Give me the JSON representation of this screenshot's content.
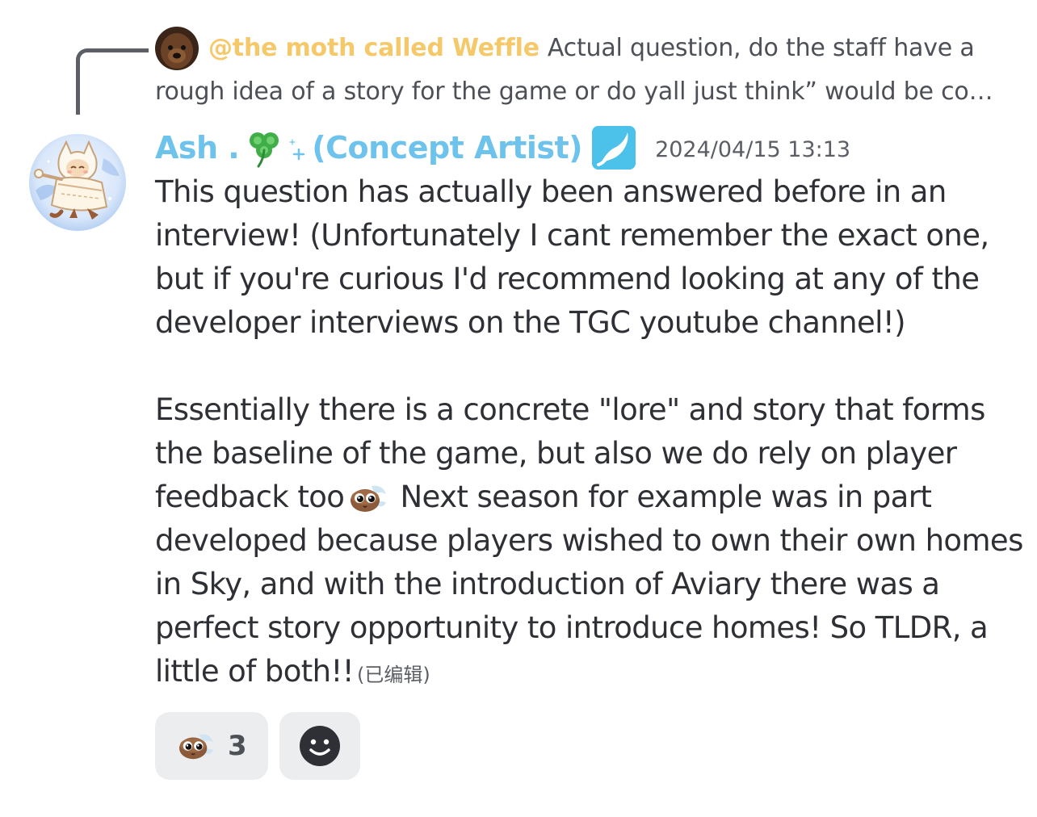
{
  "reply": {
    "author": "@the moth called Weffle",
    "preview_line1": "Actual question, do the staff have a",
    "preview_line2": "rough idea of a story for the game or do yall just think” would be co…"
  },
  "message": {
    "username_prefix": "Ash .",
    "username_suffix": "(Concept Artist)",
    "username_color": "#6ec3ec",
    "role_icon": "paint-stroke-icon",
    "timestamp": "2024/04/15 13:13",
    "lines": [
      "This question has actually been answered before in an",
      "interview! (Unfortunately I cant remember the exact one,",
      "but if you're curious I'd recommend looking at any of the",
      "developer interviews on the TGC youtube channel!)",
      "Essentially there is a concrete \"lore\" and story that forms",
      "the baseline of the game, but also we do rely on player",
      "feedback too",
      "Next season for example was in part",
      "developed because players wished to own their own homes",
      "in Sky, and with the introduction of Aviary there was a",
      "perfect story opportunity to introduce homes! So TLDR, a",
      "little of both!!"
    ],
    "edited_label": "(已编辑)"
  },
  "reactions": [
    {
      "icon": "sky-kid-emoji-icon",
      "count": "3"
    }
  ],
  "add_reaction": {
    "icon": "smiley-add-reaction-icon"
  }
}
